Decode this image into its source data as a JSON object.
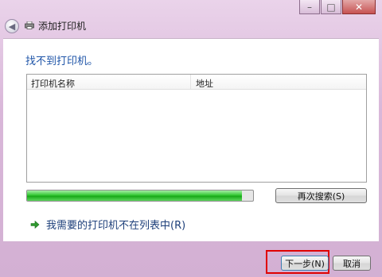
{
  "window": {
    "title": "添加打印机",
    "minimize_symbol": "–",
    "maximize_symbol": "□",
    "close_symbol": "✕"
  },
  "heading": "找不到打印机。",
  "list": {
    "columns": [
      "打印机名称",
      "地址"
    ]
  },
  "search": {
    "progress_percent": 95,
    "button_label": "再次搜索(S)"
  },
  "link": {
    "label": "我需要的打印机不在列表中(R)"
  },
  "footer": {
    "next_label": "下一步(N)",
    "cancel_label": "取消"
  },
  "colors": {
    "heading": "#1f55a8",
    "progress": "#18a818",
    "highlight": "#e00000"
  }
}
